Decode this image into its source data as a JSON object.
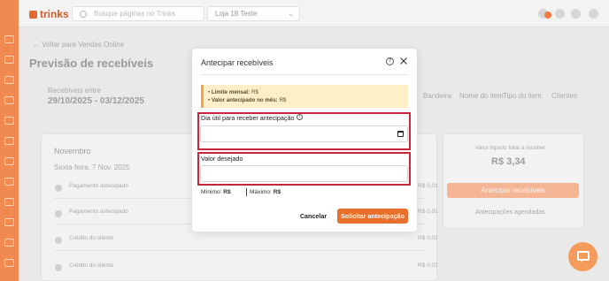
{
  "app": {
    "logo_text": "trinks"
  },
  "topbar": {
    "search_placeholder": "Busque páginas no Trinks",
    "unit_select": "Loja 18 Teste"
  },
  "background": {
    "back_link": "Voltar para Vendas Online",
    "page_title": "Previsão de recebíveis",
    "period_label": "Recebíveis entre",
    "period_value": "29/10/2025 - 03/12/2025",
    "filters": [
      "Bandeira",
      "Nome do item",
      "Tipo do item",
      "Clientes"
    ],
    "month_header": "Novembro",
    "date_subheader": "Sexta-feira, 7 Nov. 2025",
    "rows": [
      {
        "label": "Pagamento antecipado",
        "amount": "R$ 0,01"
      },
      {
        "label": "Pagamento antecipado",
        "amount": "R$ 0,01"
      },
      {
        "label": "Crédito do cliente",
        "amount": "R$ 0,02"
      },
      {
        "label": "Crédito do cliente",
        "amount": "R$ 0,02"
      }
    ],
    "summary_label": "Valor líquido total a receber",
    "summary_value": "R$ 3,34",
    "anticipate_button": "Antecipar recebíveis",
    "scheduled_link": "Antecipações agendadas"
  },
  "modal": {
    "title": "Antecipar recebíveis",
    "alert": {
      "limit_label": "Limite mensal:",
      "limit_value": "R$",
      "anticipated_label": "Valor antecipado no mês:",
      "anticipated_value": "R$"
    },
    "date_field": {
      "label": "Dia útil para receber antecipação",
      "value": ""
    },
    "amount_field": {
      "label": "Valor desejado",
      "value": "",
      "placeholder": ""
    },
    "min_label": "Mínimo:",
    "min_value": "R$",
    "max_label": "Máximo:",
    "max_value": "R$",
    "cancel_label": "Cancelar",
    "submit_label": "Solicitar antecipação"
  },
  "colors": {
    "accent": "#e8702c",
    "highlight": "#c8263a",
    "alert_bg": "#fdf0c9"
  },
  "icons": [
    "help-icon",
    "close-icon",
    "info-icon",
    "calendar-icon",
    "chat-icon",
    "search-icon"
  ]
}
